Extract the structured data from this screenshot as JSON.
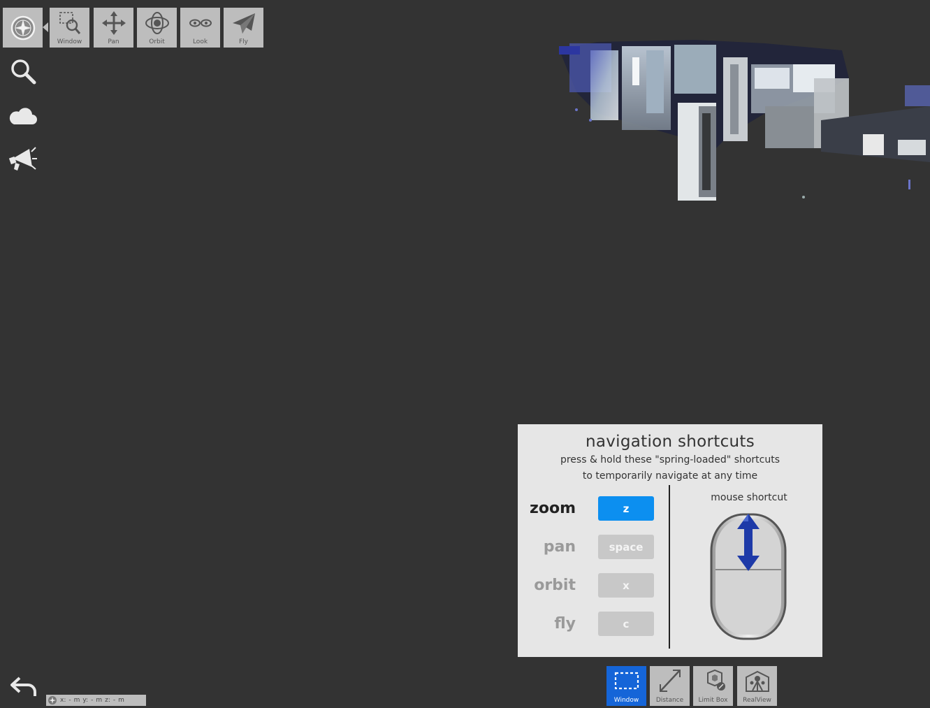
{
  "toolbar": {
    "home_icon": "compass-icon",
    "items": [
      {
        "label": "Window",
        "icon": "zoom-window-icon"
      },
      {
        "label": "Pan",
        "icon": "pan-arrows-icon"
      },
      {
        "label": "Orbit",
        "icon": "orbit-icon"
      },
      {
        "label": "Look",
        "icon": "look-eyes-icon"
      },
      {
        "label": "Fly",
        "icon": "paper-plane-icon"
      }
    ]
  },
  "side_tools": [
    "search-icon",
    "cloud-icon",
    "megaphone-icon"
  ],
  "shortcuts_panel": {
    "title": "navigation shortcuts",
    "subtitle_line1": "press & hold these \"spring-loaded\" shortcuts",
    "subtitle_line2": "to temporarily navigate at any time",
    "items": [
      {
        "label": "zoom",
        "key": "z",
        "active": true
      },
      {
        "label": "pan",
        "key": "space",
        "active": false
      },
      {
        "label": "orbit",
        "key": "x",
        "active": false
      },
      {
        "label": "fly",
        "key": "c",
        "active": false
      }
    ],
    "mouse_title": "mouse shortcut"
  },
  "bottom_tools": [
    {
      "label": "Window",
      "icon": "selection-window-icon",
      "active": true
    },
    {
      "label": "Distance",
      "icon": "distance-measure-icon",
      "active": false
    },
    {
      "label": "Limit Box",
      "icon": "limit-box-icon",
      "active": false
    },
    {
      "label": "RealView",
      "icon": "realview-icon",
      "active": false
    }
  ],
  "coordinates": {
    "x_label": "x:",
    "x_value": "-",
    "x_unit": "m",
    "y_label": "y:",
    "y_value": "-",
    "y_unit": "m",
    "z_label": "z:",
    "z_value": "-",
    "z_unit": "m"
  },
  "colors": {
    "background": "#333333",
    "toolbar_button": "#bdbdbd",
    "active_key": "#0c8ff0",
    "active_tool": "#1565d8",
    "mouse_arrow": "#1e3aa8"
  }
}
